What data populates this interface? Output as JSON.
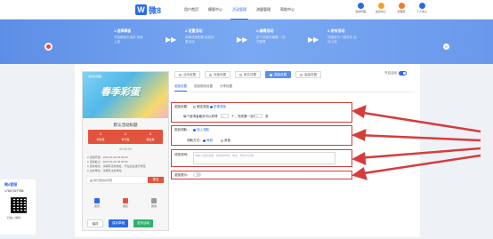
{
  "brand": {
    "logo_mark": "W",
    "logo_text": "微8"
  },
  "nav": [
    {
      "label": "用户首页"
    },
    {
      "label": "模版中心"
    },
    {
      "label": "活动管理"
    },
    {
      "label": "流量管理"
    },
    {
      "label": "帮助中心"
    }
  ],
  "top_icons": [
    {
      "label": "活动管理",
      "icon": "trophy-icon",
      "color": "#2a6ae8"
    },
    {
      "label": "会员中心",
      "icon": "crown-icon",
      "color": "#f0a32b"
    },
    {
      "label": "管理员",
      "icon": "user-icon",
      "color": "#f07a2b"
    },
    {
      "label": "个人中心",
      "icon": "person-icon",
      "color": "#2a6ae8"
    }
  ],
  "steps": [
    {
      "title": "1.选择模板",
      "desc": "丰富模板可选择 快速上线"
    },
    {
      "title": "2.设置活动",
      "desc": "简单快速配置 轻松设置活动"
    },
    {
      "title": "3.编辑活动",
      "desc": "多个页面可编辑 一站式管理"
    },
    {
      "title": "4.发布活动",
      "desc": "快速进行一键发布 活动上线"
    }
  ],
  "preview": {
    "poster_small": "活动主题图",
    "poster_title": "春季彩蛋",
    "activity_name": "默认活动标题",
    "counters": [
      {
        "num": "0",
        "label": "浏览量"
      },
      {
        "num": "0",
        "label": "参与数"
      },
      {
        "num": "0",
        "label": "报名数"
      }
    ],
    "countdown": "00:00:00",
    "info_rows": [
      "● 活动开始：2024-01-00 00:00:00",
      "● 活动截止：2024-01-00 00:00:00",
      "● 活动地址：请填写活动地址，可在后台进行修改",
      "● 主办单位：请填写主办单位"
    ],
    "join_check": "我已阅读并同意",
    "join_button": "报名",
    "tabbar": [
      {
        "label": "首页",
        "color": "#2a6ae8"
      },
      {
        "label": "报名",
        "color": "#e2533d"
      },
      {
        "label": "我的",
        "color": "#999999"
      }
    ],
    "buttons": [
      {
        "label": "保存",
        "bg": "#ffffff",
        "fg": "#333333"
      },
      {
        "label": "保存草稿",
        "bg": "#2a6ae8",
        "fg": "#ffffff"
      },
      {
        "label": "发布活动",
        "bg": "#2fb36a",
        "fg": "#ffffff"
      }
    ]
  },
  "side_panel": {
    "title": "微8客服",
    "phone": "17607927788",
    "scan_text": "扫描二维码"
  },
  "config_tabs": [
    {
      "label": "活动设置",
      "active": false
    },
    {
      "label": "页面设置",
      "active": false
    },
    {
      "label": "报名设置",
      "active": false
    },
    {
      "label": "奖励设置",
      "active": true
    },
    {
      "label": "高级设置",
      "active": false
    }
  ],
  "enable_label": "开启活动",
  "subtabs": [
    {
      "label": "奖励设置",
      "active": true
    },
    {
      "label": "奖励规则设置",
      "active": false
    },
    {
      "label": "分享设置",
      "active": false
    }
  ],
  "section1": {
    "label": "奖励设置：",
    "opt1": "固定奖励",
    "opt2": "阶梯奖励",
    "row_label": "每个邀请者最多可以获得",
    "v1": "1",
    "mid": "个，完成第一名时",
    "v2": "0",
    "end": "奖"
  },
  "section2": {
    "label": "奖品领取：",
    "opt1": "线上领取",
    "row_label": "领取方式：",
    "opt2": "商城",
    "opt3": "其他"
  },
  "section3": {
    "label": "领奖说明：",
    "placeholder": "请输入领奖说明，如领奖时间、地点、联系方式等"
  },
  "section4": {
    "label": "奖励提示："
  }
}
